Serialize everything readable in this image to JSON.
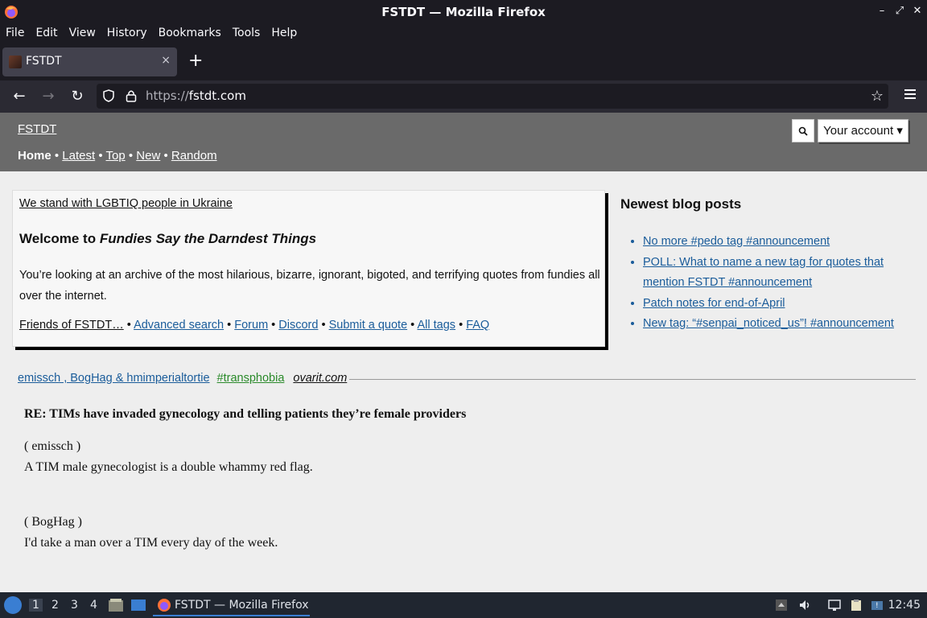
{
  "window": {
    "title": "FSTDT — Mozilla Firefox",
    "controls": [
      "–",
      "⤢",
      "✕"
    ]
  },
  "menubar": [
    "File",
    "Edit",
    "View",
    "History",
    "Bookmarks",
    "Tools",
    "Help"
  ],
  "tabs": [
    {
      "label": "FSTDT",
      "close": "×"
    }
  ],
  "new_tab": "+",
  "nav": {
    "back": "←",
    "forward": "→",
    "reload": "↻",
    "url_proto": "https://",
    "url_host": "fstdt.com",
    "bookmark_star": "☆"
  },
  "site": {
    "title": "FSTDT",
    "nav": {
      "home": "Home",
      "sep": " • ",
      "latest": "Latest",
      "top": "Top",
      "new": "New",
      "random": "Random"
    },
    "search_icon": "🔍",
    "account": "Your account ▾"
  },
  "intro": {
    "ukraine": "We stand with LGBTIQ people in Ukraine",
    "welcome_prefix": "Welcome to ",
    "welcome_italic": "Fundies Say the Darndest Things",
    "description": "You’re looking at an archive of the most hilarious, bizarre, ignorant, bigoted, and terrifying quotes from fundies all over the internet.",
    "links": [
      "Friends of FSTDT…",
      "Advanced search",
      "Forum",
      "Discord",
      "Submit a quote",
      "All tags",
      "FAQ"
    ]
  },
  "blog": {
    "heading": "Newest blog posts",
    "posts": [
      "No more #pedo tag #announcement",
      "POLL: What to name a new tag for quotes that mention FSTDT #announcement",
      "Patch notes for end-of-April",
      "New tag: “#senpai_noticed_us”! #announcement"
    ]
  },
  "quote": {
    "authors": "emissch , BogHag & hmimperialtortie",
    "tag": "#transphobia",
    "source": "ovarit.com",
    "title": "RE: TIMs have invaded gynecology and telling patients they’re female providers",
    "author1": "( emissch )",
    "text1": "A TIM male gynecologist is a double whammy red flag.",
    "author2": "( BogHag )",
    "text2": "I'd take a man over a TIM every day of the week."
  },
  "taskbar": {
    "workspaces": [
      "1",
      "2",
      "3",
      "4"
    ],
    "task_label": "FSTDT — Mozilla Firefox",
    "clock": "12:45"
  }
}
